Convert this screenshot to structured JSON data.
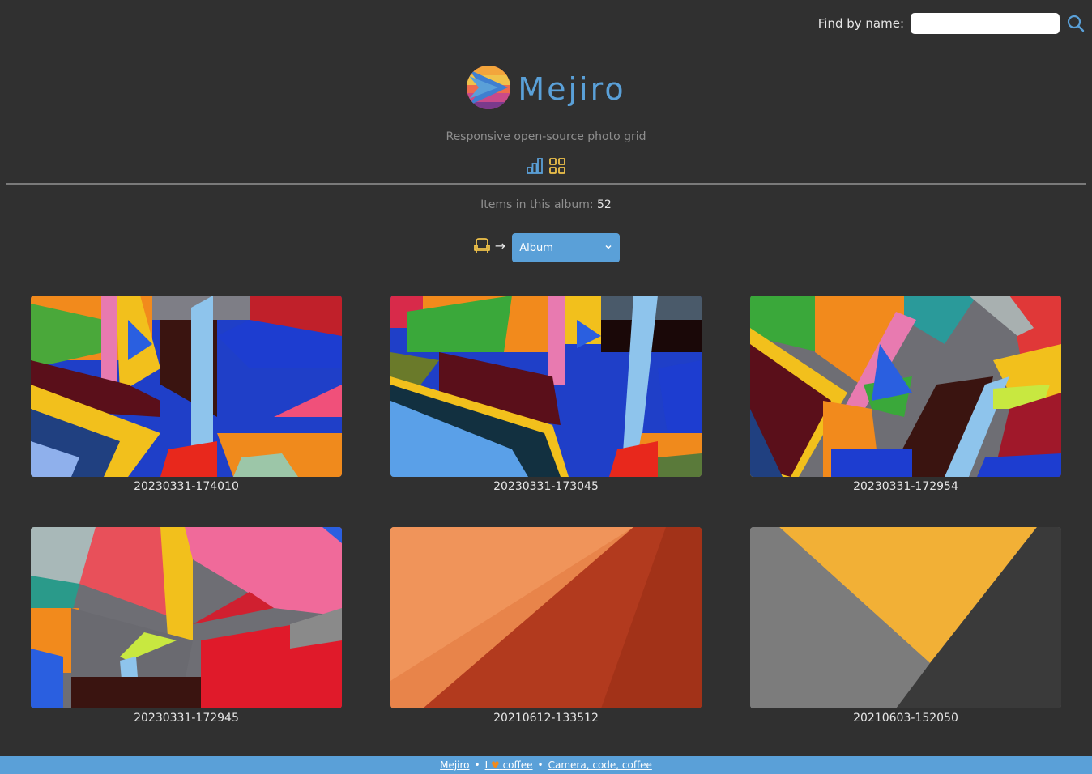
{
  "search": {
    "label": "Find by name:",
    "value": ""
  },
  "brand": {
    "name": "Mejiro",
    "tagline": "Responsive open-source photo grid"
  },
  "album": {
    "count_label": "Items in this album:",
    "count": "52",
    "arrow": "→",
    "selected": "Album"
  },
  "photos": [
    {
      "name": "20230331-174010"
    },
    {
      "name": "20230331-173045"
    },
    {
      "name": "20230331-172954"
    },
    {
      "name": "20230331-172945"
    },
    {
      "name": "20210612-133512"
    },
    {
      "name": "20210603-152050"
    }
  ],
  "footer": {
    "link1": "Mejiro",
    "sep": "•",
    "link2_pre": "I",
    "link2_post": "coffee",
    "link3": "Camera, code, coffee"
  },
  "colors": {
    "accent": "#5aa0d8",
    "background": "#303030",
    "heart": "#f08a1c"
  }
}
